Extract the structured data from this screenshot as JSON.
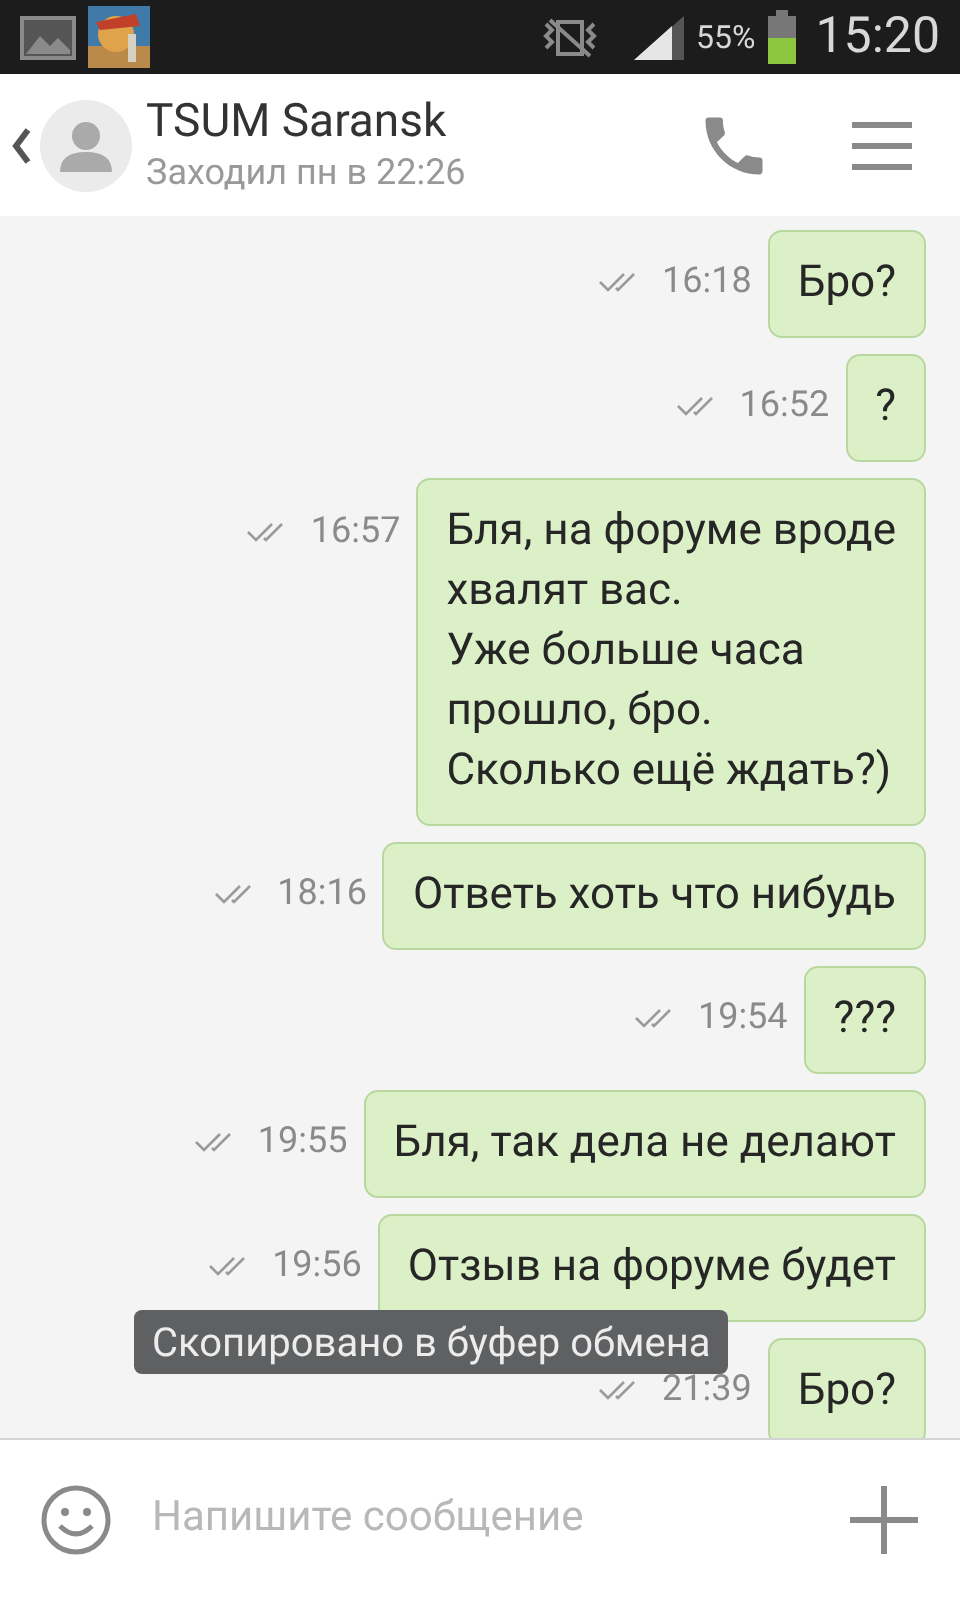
{
  "status_bar": {
    "battery": "55%",
    "time": "15:20"
  },
  "header": {
    "name": "TSUM Saransk",
    "last_seen": "Заходил пн в 22:26"
  },
  "messages": [
    {
      "text": "Бро?",
      "time": "16:18",
      "read": true
    },
    {
      "text": "?",
      "time": "16:52",
      "read": true
    },
    {
      "text": "Бля, на форуме вроде\nхвалят вас.\nУже больше часа\nпрошло, бро.\nСколько ещё ждать?)",
      "time": "16:57",
      "read": true
    },
    {
      "text": "Ответь хоть что нибудь",
      "time": "18:16",
      "read": true
    },
    {
      "text": "???",
      "time": "19:54",
      "read": true
    },
    {
      "text": "Бля, так дела не делают",
      "time": "19:55",
      "read": true
    },
    {
      "text": "Отзыв на форуме будет",
      "time": "19:56",
      "read": true
    },
    {
      "text": "Бро?",
      "time": "21:39",
      "read": true
    }
  ],
  "toast": "Скопировано в буфер обмена",
  "composer": {
    "placeholder": "Напишите сообщение"
  }
}
